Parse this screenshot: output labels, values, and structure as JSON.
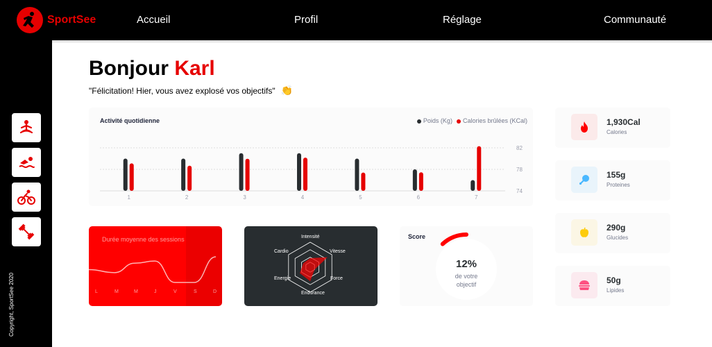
{
  "header": {
    "logo_text": "SportSee",
    "nav": [
      "Accueil",
      "Profil",
      "Réglage",
      "Communauté"
    ]
  },
  "sidebar": {
    "icons": [
      "yoga-icon",
      "swimming-icon",
      "cycling-icon",
      "dumbbell-icon"
    ],
    "copyright": "Copyright, SportSee 2020"
  },
  "greeting": {
    "hello": "Bonjour",
    "name": "Karl",
    "message": "\"Félicitation! Hier, vous avez explosé vos objectifs\"",
    "emoji": "👏"
  },
  "activity": {
    "title": "Activité quotidienne",
    "legend_weight": "Poids (Kg)",
    "legend_calories": "Calories brûlées (KCal)"
  },
  "sessions": {
    "title": "Durée moyenne des sessions",
    "days": [
      "L",
      "M",
      "M",
      "J",
      "V",
      "S",
      "D"
    ]
  },
  "performance": {
    "labels": [
      "Intensité",
      "Vitesse",
      "Force",
      "Endurance",
      "Energie",
      "Cardio"
    ]
  },
  "score": {
    "label": "Score",
    "value": "12%",
    "line1": "de votre",
    "line2": "objectif"
  },
  "key_data": [
    {
      "value": "1,930Cal",
      "label": "Calories",
      "icon": "fire-icon"
    },
    {
      "value": "155g",
      "label": "Proteines",
      "icon": "chicken-icon"
    },
    {
      "value": "290g",
      "label": "Glucides",
      "icon": "apple-icon"
    },
    {
      "value": "50g",
      "label": "Lipides",
      "icon": "burger-icon"
    }
  ],
  "colors": {
    "accent": "#e60000",
    "dark": "#282d30",
    "weight": "#282d30",
    "calories": "#e60000"
  },
  "chart_data": [
    {
      "type": "bar",
      "title": "Activité quotidienne",
      "categories": [
        "1",
        "2",
        "3",
        "4",
        "5",
        "6",
        "7"
      ],
      "series": [
        {
          "name": "Poids (Kg)",
          "values": [
            80,
            80,
            81,
            81,
            80,
            78,
            76
          ]
        },
        {
          "name": "Calories brûlées (KCal)",
          "values": [
            240,
            220,
            280,
            290,
            160,
            162,
            390
          ]
        }
      ],
      "y_ticks": [
        "74",
        "78",
        "82"
      ],
      "ylim": [
        74,
        82
      ]
    },
    {
      "type": "line",
      "title": "Durée moyenne des sessions",
      "categories": [
        "L",
        "M",
        "M",
        "J",
        "V",
        "S",
        "D"
      ],
      "values": [
        30,
        23,
        45,
        50,
        0,
        0,
        60
      ]
    },
    {
      "type": "radar",
      "categories": [
        "Intensité",
        "Vitesse",
        "Force",
        "Endurance",
        "Energie",
        "Cardio"
      ],
      "values": [
        90,
        200,
        50,
        140,
        120,
        80
      ],
      "max": 250
    },
    {
      "type": "pie",
      "title": "Score",
      "values": [
        12
      ],
      "unit": "%"
    }
  ]
}
